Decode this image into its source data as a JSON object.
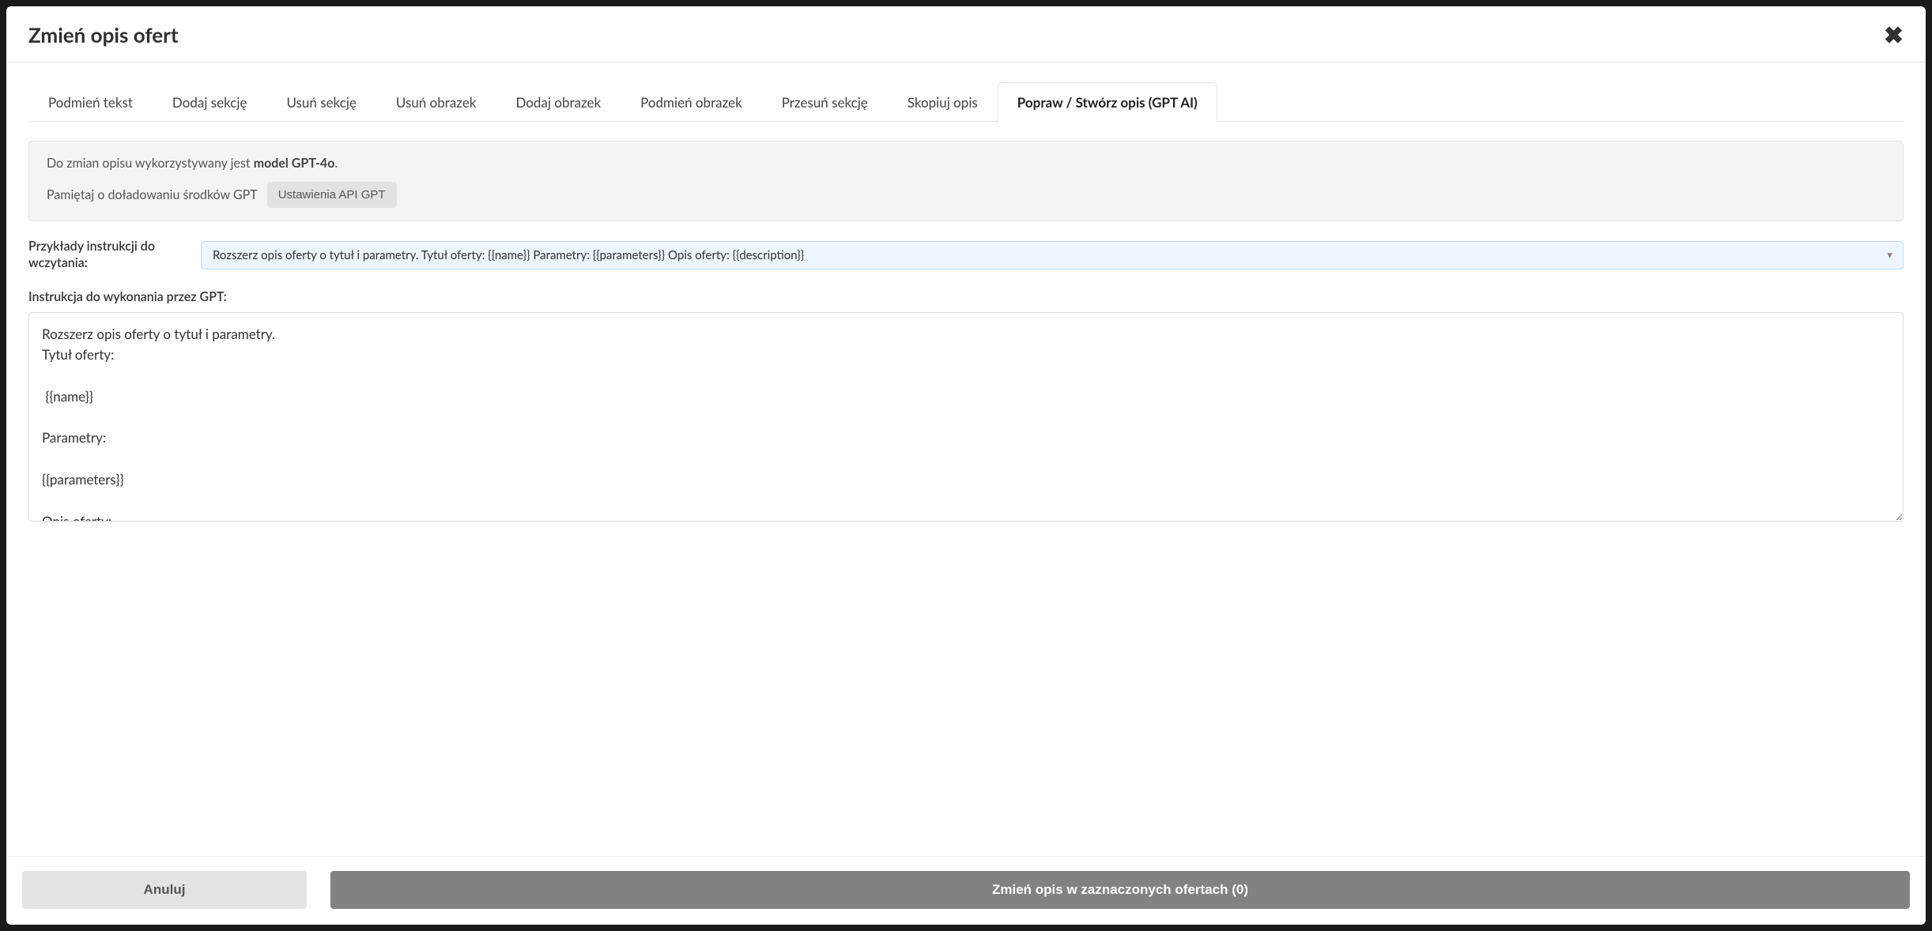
{
  "modal": {
    "title": "Zmień opis ofert"
  },
  "tabs": [
    {
      "label": "Podmień tekst",
      "active": false
    },
    {
      "label": "Dodaj sekcję",
      "active": false
    },
    {
      "label": "Usuń sekcję",
      "active": false
    },
    {
      "label": "Usuń obrazek",
      "active": false
    },
    {
      "label": "Dodaj obrazek",
      "active": false
    },
    {
      "label": "Podmień obrazek",
      "active": false
    },
    {
      "label": "Przesuń sekcję",
      "active": false
    },
    {
      "label": "Skopiuj opis",
      "active": false
    },
    {
      "label": "Popraw / Stwórz opis (GPT AI)",
      "active": true
    }
  ],
  "info": {
    "line1_prefix": "Do zmian opisu wykorzystywany jest ",
    "line1_bold": "model GPT-4o",
    "line1_suffix": ".",
    "line2_text": "Pamiętaj o doładowaniu środków GPT",
    "api_button": "Ustawienia API GPT"
  },
  "examples": {
    "label": "Przykłady instrukcji do wczytania:",
    "selected": "Rozszerz opis oferty o tytuł i parametry. Tytuł oferty: {{name}} Parametry: {{parameters}} Opis oferty: {{description}}"
  },
  "instruction": {
    "label": "Instrukcja do wykonania przez GPT:",
    "value": "Rozszerz opis oferty o tytuł i parametry.\nTytuł oferty:\n\n {{name}}\n\nParametry:\n\n{{parameters}}\n\nOpis oferty:\n\n{{description}}"
  },
  "footer": {
    "cancel": "Anuluj",
    "submit": "Zmień opis w zaznaczonych ofertach (0)"
  }
}
